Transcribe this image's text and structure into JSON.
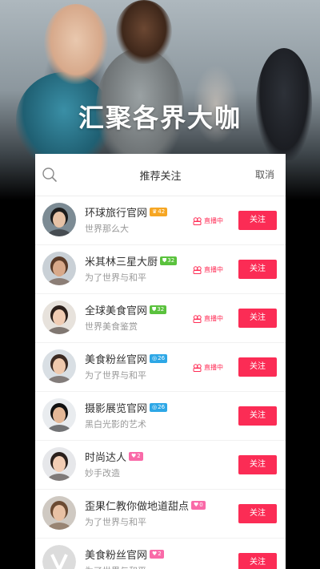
{
  "hero": {
    "title": "汇聚各界大咖"
  },
  "panel": {
    "title": "推荐关注",
    "cancel_label": "取消"
  },
  "colors": {
    "accent": "#fb2c55",
    "badge_orange": "#f6a623",
    "badge_green": "#5ac23d",
    "badge_blue": "#2da7e6",
    "badge_pink": "#f96aa8"
  },
  "live_label": "直播中",
  "follow_label": "关注",
  "accounts": [
    {
      "name": "环球旅行官网",
      "badge": {
        "text": "42",
        "icon": "crown-icon",
        "color": "#f6a623"
      },
      "subtitle": "世界那么大",
      "live": true
    },
    {
      "name": "米其林三星大厨",
      "badge": {
        "text": "32",
        "icon": "shield-icon",
        "color": "#5ac23d"
      },
      "subtitle": "为了世界与和平",
      "live": true
    },
    {
      "name": "全球美食官网",
      "badge": {
        "text": "32",
        "icon": "shield-icon",
        "color": "#5ac23d"
      },
      "subtitle": "世界美食鉴赏",
      "live": true
    },
    {
      "name": "美食粉丝官网",
      "badge": {
        "text": "26",
        "icon": "target-icon",
        "color": "#2da7e6"
      },
      "subtitle": "为了世界与和平",
      "live": true
    },
    {
      "name": "摄影展览官网",
      "badge": {
        "text": "26",
        "icon": "target-icon",
        "color": "#2da7e6"
      },
      "subtitle": "黑白光影的艺术",
      "live": false
    },
    {
      "name": "时尚达人",
      "badge": {
        "text": "2",
        "icon": "heart-icon",
        "color": "#f96aa8"
      },
      "subtitle": "妙手改造",
      "live": false
    },
    {
      "name": "歪果仁教你做地道甜点",
      "badge": {
        "text": "0",
        "icon": "heart-icon",
        "color": "#f96aa8"
      },
      "subtitle": "为了世界与和平",
      "live": false
    },
    {
      "name": "美食粉丝官网",
      "badge": {
        "text": "2",
        "icon": "heart-icon",
        "color": "#f96aa8"
      },
      "subtitle": "为了世界与和平",
      "live": false
    }
  ]
}
